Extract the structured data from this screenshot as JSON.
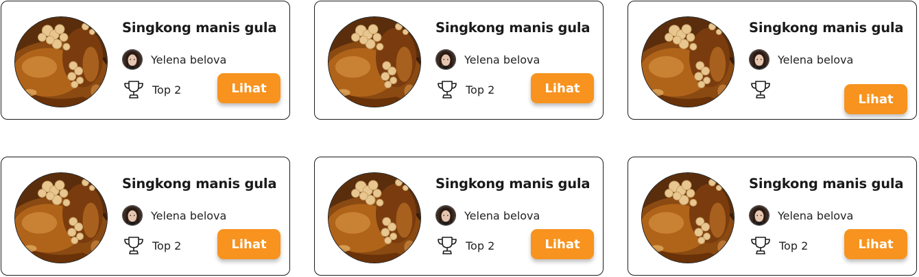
{
  "cards": [
    {
      "title": "Singkong manis gula",
      "author": "Yelena belova",
      "rank": "Top 2",
      "button_label": "Lihat"
    },
    {
      "title": "Singkong manis gula",
      "author": "Yelena belova",
      "rank": "Top 2",
      "button_label": "Lihat"
    },
    {
      "title": "Singkong manis gula",
      "author": "Yelena belova",
      "rank": "",
      "button_label": "Lihat"
    },
    {
      "title": "Singkong manis gula",
      "author": "Yelena belova",
      "rank": "Top 2",
      "button_label": "Lihat"
    },
    {
      "title": "Singkong manis gula",
      "author": "Yelena belova",
      "rank": "Top 2",
      "button_label": "Lihat"
    },
    {
      "title": "Singkong manis gula",
      "author": "Yelena belova",
      "rank": "Top 2",
      "button_label": "Lihat"
    }
  ],
  "icons": {
    "rank": "trophy-icon",
    "author": "avatar",
    "photo": "food-photo"
  },
  "colors": {
    "button": "#f7931e",
    "button_text": "#ffffff",
    "border": "#1a1a1a"
  }
}
